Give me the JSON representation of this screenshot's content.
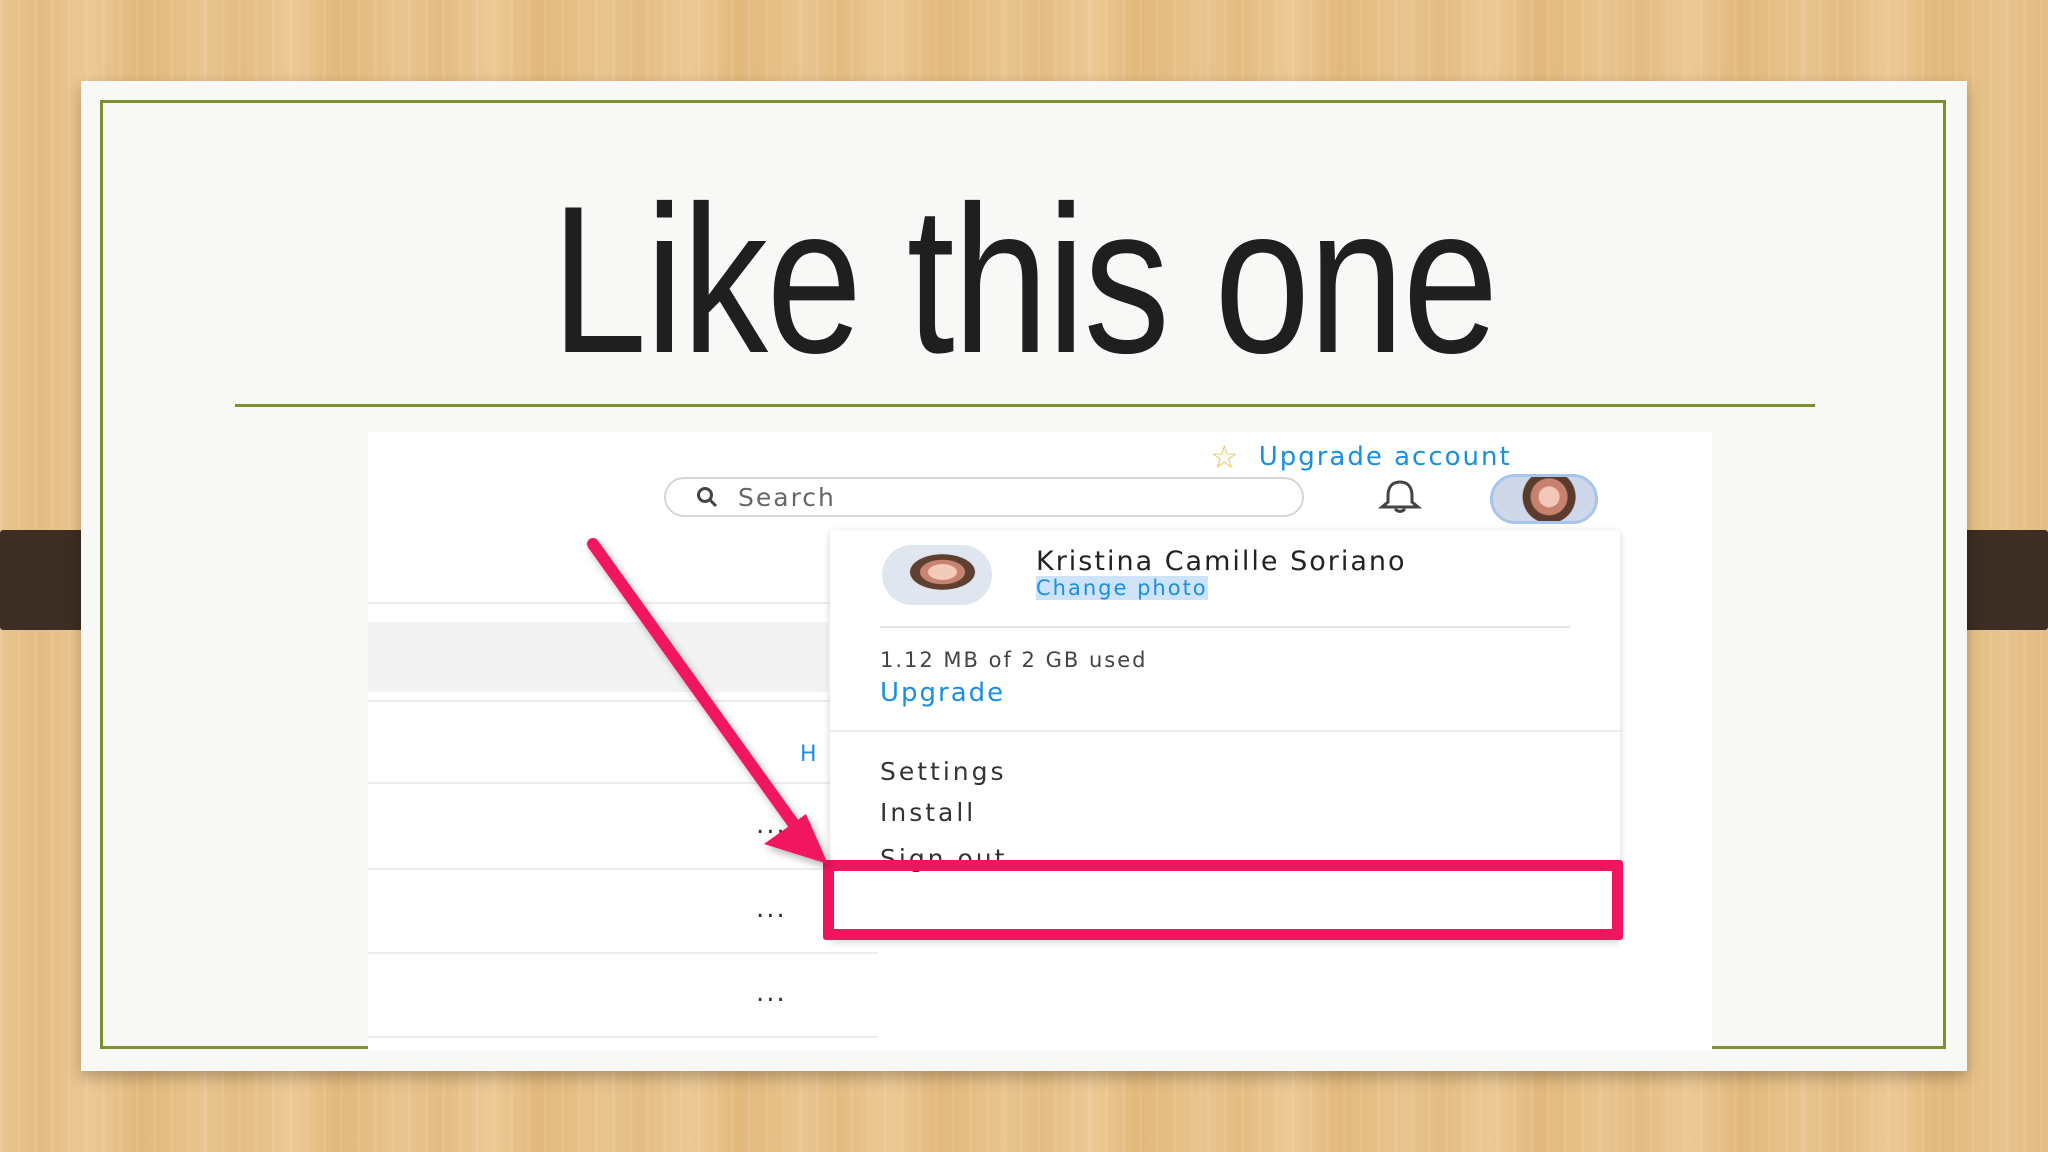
{
  "slide": {
    "title": "Like this one"
  },
  "screenshot": {
    "header": {
      "upgrade_account": "Upgrade account",
      "search_placeholder": "Search"
    },
    "background": {
      "link_fragment": "H",
      "row_menu": "..."
    },
    "account_menu": {
      "user_name": "Kristina Camille Soriano",
      "change_photo": "Change photo",
      "storage_usage": "1.12 MB of 2 GB used",
      "upgrade": "Upgrade",
      "settings": "Settings",
      "install": "Install",
      "sign_out": "Sign out"
    }
  },
  "colors": {
    "accent_link": "#1a8fe0",
    "highlight": "#f0155f",
    "frame": "#7a8f2e"
  },
  "icons": [
    "star-icon",
    "search-icon",
    "bell-icon",
    "avatar",
    "arrow-annotation"
  ]
}
